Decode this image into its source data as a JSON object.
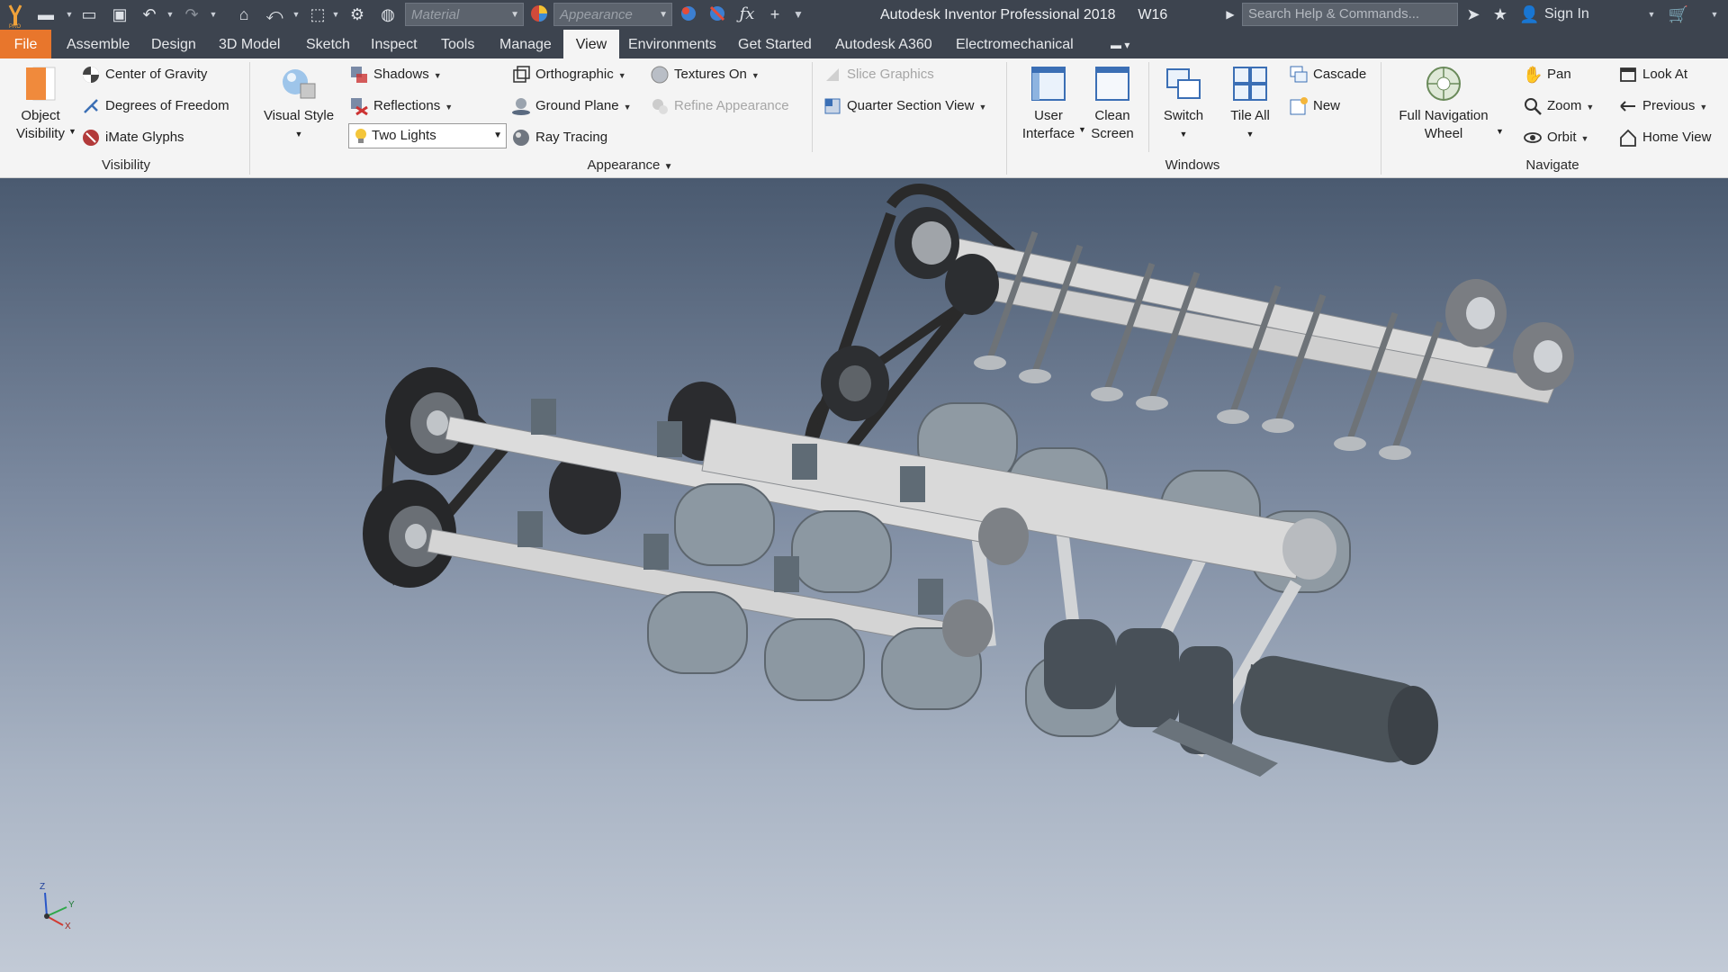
{
  "colors": {
    "accent_file": "#e8762c",
    "titlebar": "#3d444f",
    "ribbon": "#f4f4f4"
  },
  "quick_access": {
    "material_placeholder": "Material",
    "appearance_placeholder": "Appearance",
    "icons": [
      "inventor-logo-icon",
      "new-icon",
      "open-icon",
      "save-icon",
      "undo-icon",
      "redo-icon",
      "home-icon",
      "return-icon",
      "select-icon",
      "update-icon",
      "color-override-icon",
      "clear-override-icon",
      "fx-icon",
      "plus-icon",
      "customize-icon"
    ]
  },
  "app_title": "Autodesk Inventor Professional 2018",
  "doc_name": "W16",
  "search_placeholder": "Search Help & Commands...",
  "sign_in": "Sign In",
  "tabs": [
    "File",
    "Assemble",
    "Design",
    "3D Model",
    "Sketch",
    "Inspect",
    "Tools",
    "Manage",
    "View",
    "Environments",
    "Get Started",
    "Autodesk A360",
    "Electromechanical"
  ],
  "active_tab": "View",
  "ribbon": {
    "visibility": {
      "title": "Visibility",
      "object_visibility": "Object Visibility",
      "object_visibility_l1": "Object",
      "object_visibility_l2": "Visibility",
      "center_of_gravity": "Center of Gravity",
      "degrees_of_freedom": "Degrees of Freedom",
      "imate_glyphs": "iMate Glyphs"
    },
    "appearance": {
      "title": "Appearance",
      "visual_style": "Visual Style",
      "shadows": "Shadows",
      "reflections": "Reflections",
      "lighting": "Two Lights",
      "orthographic": "Orthographic",
      "ground_plane": "Ground Plane",
      "ray_tracing": "Ray Tracing",
      "textures": "Textures On",
      "refine_appearance": "Refine Appearance",
      "slice_graphics": "Slice Graphics",
      "quarter_section": "Quarter Section View"
    },
    "windows": {
      "title": "Windows",
      "user_interface_l1": "User",
      "user_interface_l2": "Interface",
      "clean_screen_l1": "Clean",
      "clean_screen_l2": "Screen",
      "switch": "Switch",
      "tile_all": "Tile All",
      "cascade": "Cascade",
      "new": "New"
    },
    "navigate": {
      "title": "Navigate",
      "full_nav_l1": "Full Navigation",
      "full_nav_l2": "Wheel",
      "pan": "Pan",
      "zoom": "Zoom",
      "orbit": "Orbit",
      "look_at": "Look At",
      "previous": "Previous",
      "home_view": "Home View"
    }
  },
  "axis_triad": {
    "x": "X",
    "y": "Y",
    "z": "Z"
  }
}
